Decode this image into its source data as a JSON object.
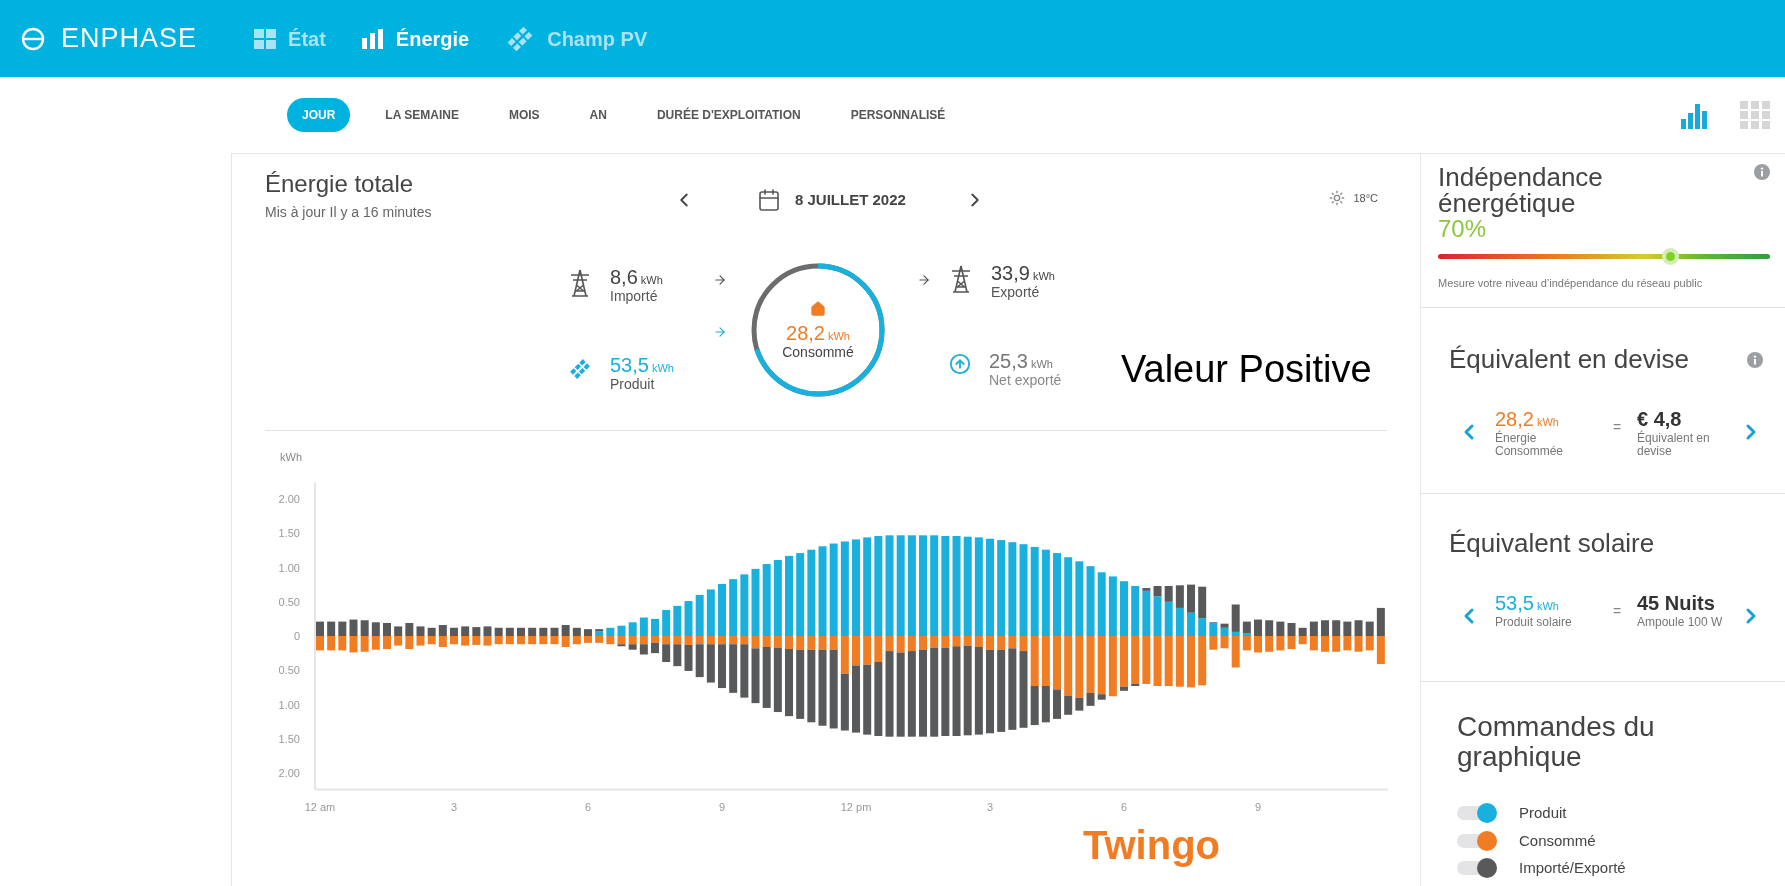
{
  "header": {
    "logo": "ENPHASE",
    "nav": [
      {
        "label": "État",
        "kind": "status",
        "selected": false
      },
      {
        "label": "Énergie",
        "kind": "energy",
        "selected": true
      },
      {
        "label": "Champ PV",
        "kind": "array",
        "selected": false
      }
    ]
  },
  "period_tabs": [
    {
      "label": "JOUR",
      "selected": true
    },
    {
      "label": "LA SEMAINE",
      "selected": false
    },
    {
      "label": "MOIS",
      "selected": false
    },
    {
      "label": "AN",
      "selected": false
    },
    {
      "label": "DURÉE D'EXPLOITATION",
      "selected": false
    },
    {
      "label": "PERSONNALISÉ",
      "selected": false
    }
  ],
  "view_toggles": [
    {
      "kind": "chart",
      "selected": true
    },
    {
      "kind": "grid",
      "selected": false
    }
  ],
  "summary": {
    "title": "Énergie totale",
    "updated": "Mis à jour Il y a 16 minutes",
    "date": "8 JUILLET 2022",
    "weather": "18°C",
    "imported": {
      "value": "8,6",
      "unit": "kWh",
      "label": "Importé"
    },
    "produced": {
      "value": "53,5",
      "unit": "kWh",
      "label": "Produit"
    },
    "consumed": {
      "value": "28,2",
      "unit": "kWh",
      "label": "Consommé",
      "level": 0.7
    },
    "exported": {
      "value": "33,9",
      "unit": "kWh",
      "label": "Exporté"
    },
    "net_exported": {
      "value": "25,3",
      "unit": "kWh",
      "label": "Net exporté"
    }
  },
  "chart": {
    "time_labels": [
      "12 am",
      "3",
      "6",
      "9",
      "12 pm",
      "3",
      "6",
      "9"
    ],
    "chart_data": {
      "type": "bar",
      "stacked": true,
      "ylabel": "kWh",
      "ylim": [
        -2.24,
        2.24
      ],
      "yticks": [
        {
          "value": 2,
          "label": "2.00"
        },
        {
          "value": 1.5,
          "label": "1.50"
        },
        {
          "value": 1,
          "label": "1.00"
        },
        {
          "value": 0.5,
          "label": "0.50"
        },
        0,
        {
          "value": -0.5,
          "label": "0.50"
        },
        {
          "value": -1,
          "label": "1.00"
        },
        {
          "value": -1.5,
          "label": "1.50"
        },
        {
          "value": -2,
          "label": "2.00"
        }
      ],
      "series": [
        {
          "name": "Produit",
          "color": "#1ab0dd",
          "values": [
            0,
            0,
            0,
            0,
            0,
            0,
            0,
            0,
            0,
            0,
            0,
            0,
            0,
            0,
            0,
            0,
            0,
            0,
            0,
            0,
            0,
            0,
            0,
            0,
            0,
            0.07,
            0.12,
            0.15,
            0.2,
            0.27,
            0.25,
            0.38,
            0.44,
            0.51,
            0.6,
            0.68,
            0.76,
            0.83,
            0.9,
            0.98,
            1.05,
            1.11,
            1.17,
            1.21,
            1.26,
            1.31,
            1.35,
            1.38,
            1.41,
            1.44,
            1.46,
            1.47,
            1.47,
            1.47,
            1.47,
            1.47,
            1.46,
            1.46,
            1.45,
            1.44,
            1.42,
            1.4,
            1.37,
            1.34,
            1.3,
            1.26,
            1.21,
            1.15,
            1.09,
            1.02,
            0.93,
            0.87,
            0.8,
            0.73,
            0.66,
            0.58,
            0.5,
            0.41,
            0.34,
            0.26,
            0.19,
            0.12,
            0.06,
            0.04,
            0,
            0,
            0,
            0,
            0,
            0,
            0,
            0,
            0,
            0,
            0,
            0
          ]
        },
        {
          "name": "Consommé",
          "color": "#f07c24",
          "values": [
            -0.21,
            -0.21,
            -0.21,
            -0.24,
            -0.23,
            -0.2,
            -0.19,
            -0.14,
            -0.19,
            -0.14,
            -0.12,
            -0.16,
            -0.12,
            -0.14,
            -0.13,
            -0.14,
            -0.12,
            -0.12,
            -0.12,
            -0.12,
            -0.12,
            -0.12,
            -0.16,
            -0.12,
            -0.1,
            -0.1,
            -0.12,
            -0.12,
            -0.12,
            -0.12,
            -0.1,
            -0.12,
            -0.12,
            -0.13,
            -0.12,
            -0.12,
            -0.12,
            -0.12,
            -0.12,
            -0.18,
            -0.16,
            -0.17,
            -0.19,
            -0.2,
            -0.2,
            -0.2,
            -0.2,
            -0.55,
            -0.43,
            -0.42,
            -0.38,
            -0.22,
            -0.24,
            -0.22,
            -0.2,
            -0.17,
            -0.17,
            -0.15,
            -0.14,
            -0.16,
            -0.2,
            -0.2,
            -0.18,
            -0.22,
            -0.73,
            -0.73,
            -0.78,
            -0.87,
            -0.9,
            -0.83,
            -0.85,
            -0.88,
            -0.74,
            -0.7,
            -0.7,
            -0.73,
            -0.73,
            -0.74,
            -0.75,
            -0.72,
            -0.2,
            -0.18,
            -0.46,
            -0.21,
            -0.24,
            -0.23,
            -0.21,
            -0.19,
            -0.12,
            -0.21,
            -0.23,
            -0.23,
            -0.21,
            -0.23,
            -0.21,
            -0.41
          ]
        },
        {
          "name": "Importé/Exporté",
          "color": "#58595b",
          "values": [
            0.21,
            0.21,
            0.21,
            0.24,
            0.23,
            0.2,
            0.19,
            0.14,
            0.19,
            0.14,
            0.12,
            0.16,
            0.12,
            0.14,
            0.13,
            0.14,
            0.12,
            0.12,
            0.12,
            0.12,
            0.12,
            0.12,
            0.16,
            0.12,
            0.1,
            0.03,
            0,
            -0.03,
            -0.08,
            -0.15,
            -0.15,
            -0.26,
            -0.32,
            -0.38,
            -0.48,
            -0.56,
            -0.64,
            -0.71,
            -0.78,
            -0.8,
            -0.89,
            -0.94,
            -0.98,
            -1.01,
            -1.06,
            -1.11,
            -1.15,
            -0.83,
            -0.98,
            -1.02,
            -1.08,
            -1.25,
            -1.23,
            -1.25,
            -1.27,
            -1.3,
            -1.29,
            -1.31,
            -1.31,
            -1.28,
            -1.22,
            -1.2,
            -1.19,
            -1.12,
            -0.57,
            -0.53,
            -0.43,
            -0.28,
            -0.19,
            -0.19,
            -0.08,
            null,
            -0.06,
            -0.03,
            0.04,
            0.15,
            0.23,
            0.33,
            0.41,
            0.46,
            0.01,
            0.06,
            0.4,
            0.17,
            0.24,
            0.23,
            0.21,
            0.19,
            0.12,
            0.21,
            0.23,
            0.23,
            0.21,
            0.23,
            0.21,
            0.41
          ]
        }
      ]
    }
  },
  "independence": {
    "title": "Indépendance énergétique",
    "value": "70%",
    "level": 0.7,
    "caption": "Mesure votre niveau d’indépendance du réseau public"
  },
  "currency": {
    "title": "Équivalent en devise",
    "input": {
      "value": "28,2",
      "unit": "kWh",
      "label": "Énergie Consommée"
    },
    "equals": "=",
    "output": {
      "value": "€ 4,8",
      "label": "Équivalent en devise"
    }
  },
  "solar": {
    "title": "Équivalent solaire",
    "input": {
      "value": "53,5",
      "unit": "kWh",
      "label": "Produit solaire"
    },
    "equals": "=",
    "output": {
      "value": "45 Nuits",
      "label": "Ampoule 100 W"
    }
  },
  "chart_controls": {
    "title": "Commandes du graphique",
    "toggles": [
      {
        "on": true
      },
      {
        "on": true
      },
      {
        "on": true
      }
    ]
  },
  "annotations": [
    {
      "kind": "note",
      "text": "Valeur Positive"
    },
    {
      "kind": "highlight",
      "text": "Twingo"
    }
  ]
}
